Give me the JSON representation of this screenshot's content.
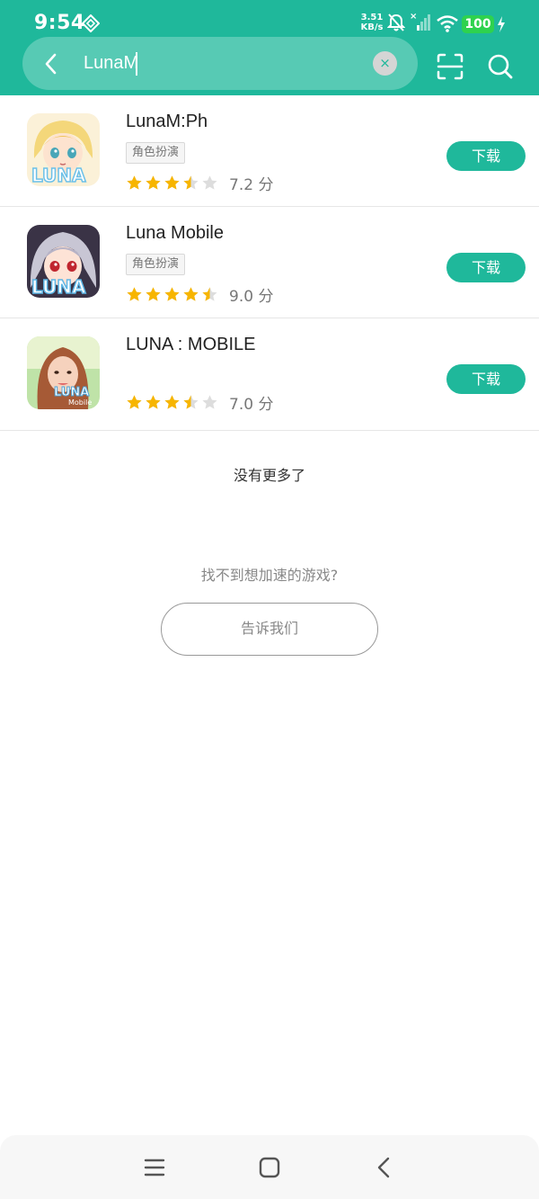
{
  "status_bar": {
    "time": "9:54",
    "net_speed_value": "3.51",
    "net_speed_unit": "KB/s",
    "battery": "100",
    "icons": [
      "data-saver-diamond-icon",
      "mute-bell-icon",
      "signal-icon",
      "wifi-icon",
      "charging-bolt-icon"
    ]
  },
  "search": {
    "query": "LunaM",
    "clear_label": "×"
  },
  "apps": [
    {
      "name": "LunaM:Ph",
      "tag": "角色扮演",
      "rating": 3.5,
      "score_text": "7.2 分",
      "download_label": "下载"
    },
    {
      "name": "Luna Mobile",
      "tag": "角色扮演",
      "rating": 4.5,
      "score_text": "9.0 分",
      "download_label": "下载"
    },
    {
      "name": "LUNA : MOBILE",
      "tag": "",
      "rating": 3.5,
      "score_text": "7.0 分",
      "download_label": "下载"
    }
  ],
  "footer": {
    "no_more": "没有更多了",
    "cant_find": "找不到想加速的游戏?",
    "tell_us": "告诉我们"
  },
  "colors": {
    "accent": "#1fb89b",
    "star": "#f7b500",
    "star_empty": "#dddddd"
  }
}
